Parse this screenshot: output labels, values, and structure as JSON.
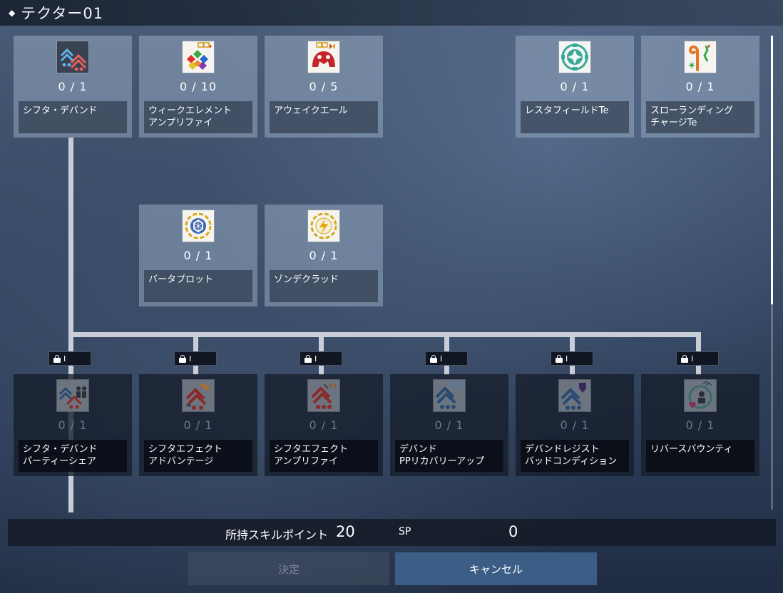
{
  "window": {
    "title": "テクター01"
  },
  "skills": [
    {
      "id": "sdf",
      "name_lines": [
        "シフタ・デバンド"
      ],
      "level": "0 / 1",
      "icon": "shifta-deband-icon",
      "locked": false
    },
    {
      "id": "wea",
      "name_lines": [
        "ウィークエレメント",
        "アンプリファイ"
      ],
      "level": "0 / 10",
      "icon": "weak-element-icon",
      "locked": false
    },
    {
      "id": "awe",
      "name_lines": [
        "アウェイクエール"
      ],
      "level": "0 / 5",
      "icon": "awake-ale-icon",
      "locked": false
    },
    {
      "id": "rft",
      "name_lines": [
        "レスタフィールドTe"
      ],
      "level": "0 / 1",
      "icon": "resta-field-icon",
      "locked": false
    },
    {
      "id": "slc",
      "name_lines": [
        "スローランディング",
        "チャージTe"
      ],
      "level": "0 / 1",
      "icon": "slow-landing-icon",
      "locked": false
    },
    {
      "id": "bar",
      "name_lines": [
        "バータプロット"
      ],
      "level": "0 / 1",
      "icon": "barta-plot-icon",
      "locked": false
    },
    {
      "id": "zon",
      "name_lines": [
        "ゾンデクラッド"
      ],
      "level": "0 / 1",
      "icon": "zonde-clad-icon",
      "locked": false
    },
    {
      "id": "sps",
      "name_lines": [
        "シフタ・デバンド",
        "パーティーシェア"
      ],
      "level": "0 / 1",
      "icon": "party-share-icon",
      "locked": true
    },
    {
      "id": "sea",
      "name_lines": [
        "シフタエフェクト",
        "アドバンテージ"
      ],
      "level": "0 / 1",
      "icon": "shifta-advantage-icon",
      "locked": true
    },
    {
      "id": "sam",
      "name_lines": [
        "シフタエフェクト",
        "アンプリファイ"
      ],
      "level": "0 / 1",
      "icon": "shifta-amplify-icon",
      "locked": true
    },
    {
      "id": "dpr",
      "name_lines": [
        "デバンド",
        "PPリカバリーアップ"
      ],
      "level": "0 / 1",
      "icon": "deband-pp-icon",
      "locked": true
    },
    {
      "id": "drb",
      "name_lines": [
        "デバンドレジスト",
        "バッドコンディション"
      ],
      "level": "0 / 1",
      "icon": "deband-resist-icon",
      "locked": true
    },
    {
      "id": "rvb",
      "name_lines": [
        "リバースバウンティ"
      ],
      "level": "0 / 1",
      "icon": "reverse-bounty-icon",
      "locked": true
    }
  ],
  "lock_label": "I",
  "footer": {
    "sp_label": "所持スキルポイント",
    "sp_value": "20",
    "sp_unit": "SP",
    "sp_used": "0",
    "confirm_label": "決定",
    "cancel_label": "キャンセル"
  },
  "colors": {
    "accent_button": "#3c5e86",
    "node_unlocked": "#8fa0b8",
    "node_locked": "#161e2c",
    "tree_line": "#c9ced6"
  },
  "scroll_position": 0.0
}
